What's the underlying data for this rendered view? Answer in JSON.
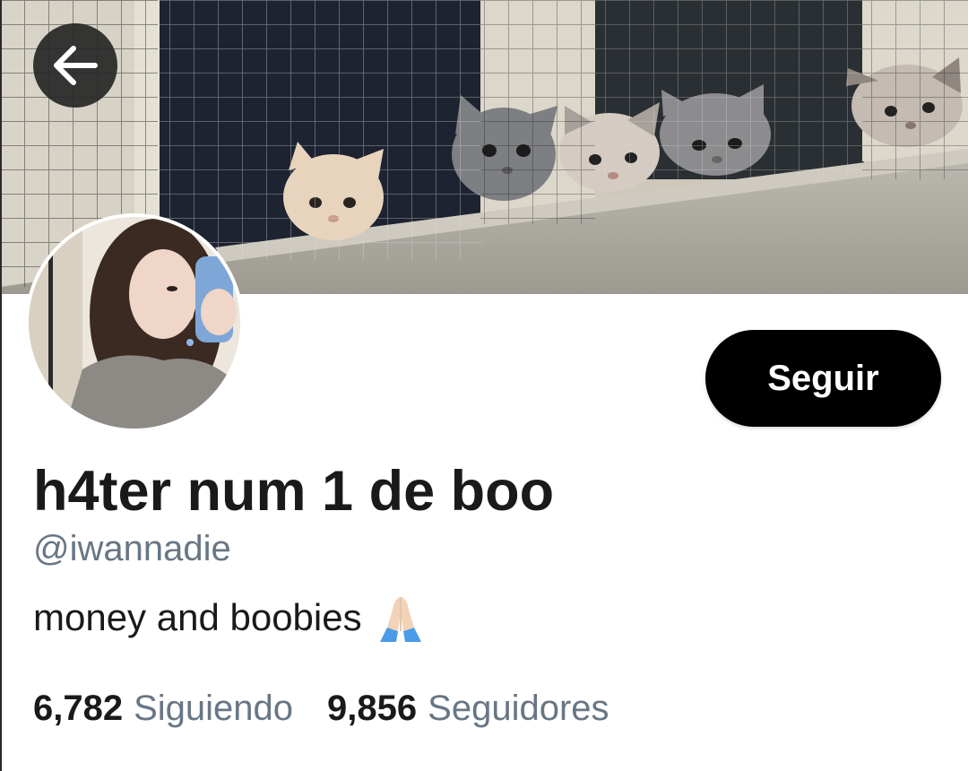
{
  "header": {
    "back_icon": "arrow-left-icon",
    "banner_description_icon": "cats-banner-image"
  },
  "profile": {
    "display_name": "h4ter num 1 de boo",
    "handle": "@iwannadie",
    "bio_text": "money and boobies",
    "bio_emoji": "folded-hands-icon",
    "follow_label": "Seguir"
  },
  "stats": {
    "following_count": "6,782",
    "following_label": "Siguiendo",
    "followers_count": "9,856",
    "followers_label": "Seguidores"
  },
  "colors": {
    "follow_button_bg": "#000000",
    "follow_button_text": "#ffffff",
    "secondary_text": "#687684",
    "primary_text": "#1a1a1a",
    "back_button_bg": "#262626"
  }
}
